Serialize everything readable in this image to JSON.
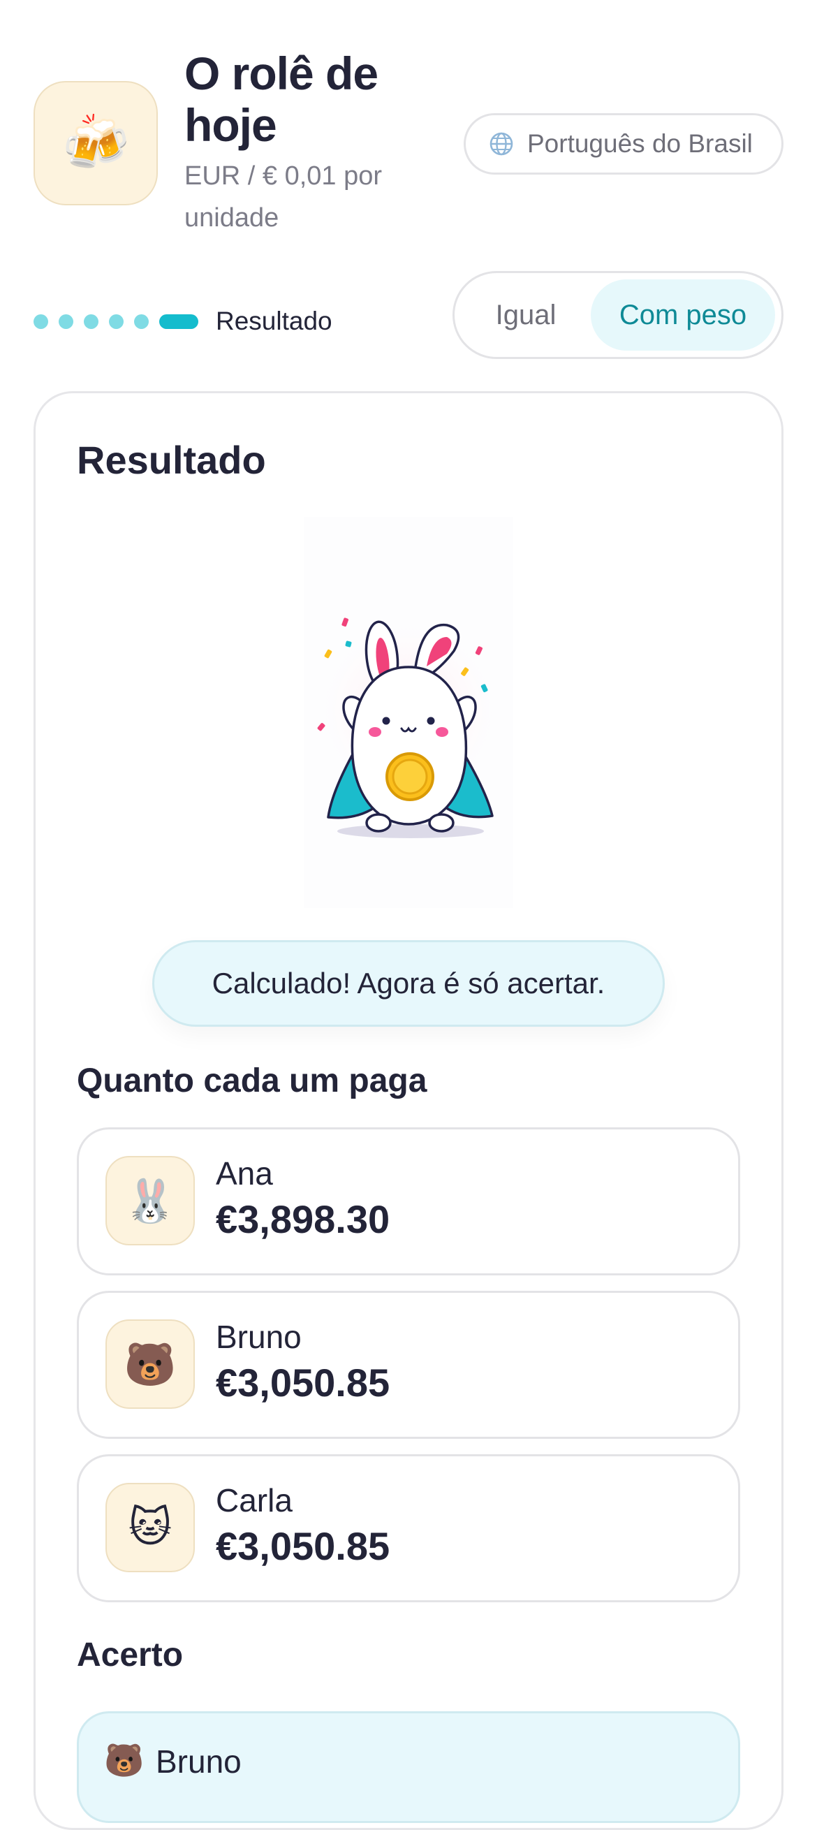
{
  "header": {
    "app_icon": "beer-mugs-icon",
    "app_icon_glyph": "🍻",
    "title": "O rolê de hoje",
    "subtitle": "EUR / € 0,01 por unidade",
    "language_icon": "globe-icon",
    "language": "Português do Brasil"
  },
  "progress": {
    "total_steps": 6,
    "current_step": 6,
    "label": "Resultado"
  },
  "split_mode": {
    "options": [
      "Igual",
      "Com peso"
    ],
    "selected": "Com peso"
  },
  "result": {
    "title": "Resultado",
    "illustration": "celebrating-bunny-coin",
    "message": "Calculado! Agora é só acertar."
  },
  "payments": {
    "title": "Quanto cada um paga",
    "people": [
      {
        "name": "Ana",
        "amount": "€3,898.30",
        "avatar": "rabbit-icon",
        "glyph": "🐰"
      },
      {
        "name": "Bruno",
        "amount": "€3,050.85",
        "avatar": "bear-icon",
        "glyph": "🐻"
      },
      {
        "name": "Carla",
        "amount": "€3,050.85",
        "avatar": "cat-icon",
        "glyph": "🐱"
      }
    ]
  },
  "settlement": {
    "title": "Acerto",
    "first_name": "Bruno",
    "first_avatar": "bear-icon",
    "first_glyph": "🐻"
  },
  "colors": {
    "accent": "#14bccd",
    "accent_light": "#7fdbe4",
    "text": "#232438",
    "muted": "#7c7c88",
    "highlight_bg": "#e7f8fc",
    "avatar_bg": "#fdf3de"
  }
}
